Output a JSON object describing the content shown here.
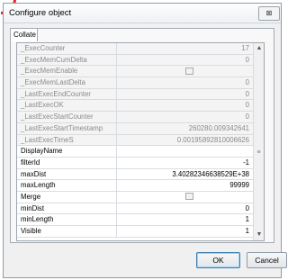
{
  "window": {
    "title": "Configure object",
    "close_glyph": "⊠"
  },
  "tab": {
    "label": "Collate"
  },
  "properties": [
    {
      "name": "_ExecCounter",
      "value": "17",
      "readonly": true,
      "checkbox": false
    },
    {
      "name": "_ExecMemCumDelta",
      "value": "0",
      "readonly": true,
      "checkbox": false
    },
    {
      "name": "_ExecMemEnable",
      "value": "",
      "readonly": true,
      "checkbox": true
    },
    {
      "name": "_ExecMemLastDelta",
      "value": "0",
      "readonly": true,
      "checkbox": false
    },
    {
      "name": "_LastExecEndCounter",
      "value": "0",
      "readonly": true,
      "checkbox": false
    },
    {
      "name": "_LastExecOK",
      "value": "0",
      "readonly": true,
      "checkbox": false
    },
    {
      "name": "_LastExecStartCounter",
      "value": "0",
      "readonly": true,
      "checkbox": false
    },
    {
      "name": "_LastExecStartTimestamp",
      "value": "260280.009342641",
      "readonly": true,
      "checkbox": false
    },
    {
      "name": "_LastExecTimeS",
      "value": "0.00195892810006626",
      "readonly": true,
      "checkbox": false
    },
    {
      "name": "DisplayName",
      "value": "",
      "readonly": false,
      "checkbox": false
    },
    {
      "name": "filterId",
      "value": "-1",
      "readonly": false,
      "checkbox": false
    },
    {
      "name": "maxDist",
      "value": "3.40282346638529E+38",
      "readonly": false,
      "checkbox": false
    },
    {
      "name": "maxLength",
      "value": "99999",
      "readonly": false,
      "checkbox": false
    },
    {
      "name": "Merge",
      "value": "",
      "readonly": false,
      "checkbox": true
    },
    {
      "name": "minDist",
      "value": "0",
      "readonly": false,
      "checkbox": false
    },
    {
      "name": "minLength",
      "value": "1",
      "readonly": false,
      "checkbox": false
    },
    {
      "name": "Visible",
      "value": "1",
      "readonly": false,
      "checkbox": false
    }
  ],
  "scrollbar": {
    "up_glyph": "▲",
    "down_glyph": "▼",
    "grip_glyph": "≡"
  },
  "buttons": {
    "ok": "OK",
    "cancel": "Cancel"
  },
  "colors": {
    "annotation_red": "#e8252a",
    "readonly_text": "#8a8a8a",
    "dialog_bg": "#f0f0f0"
  }
}
